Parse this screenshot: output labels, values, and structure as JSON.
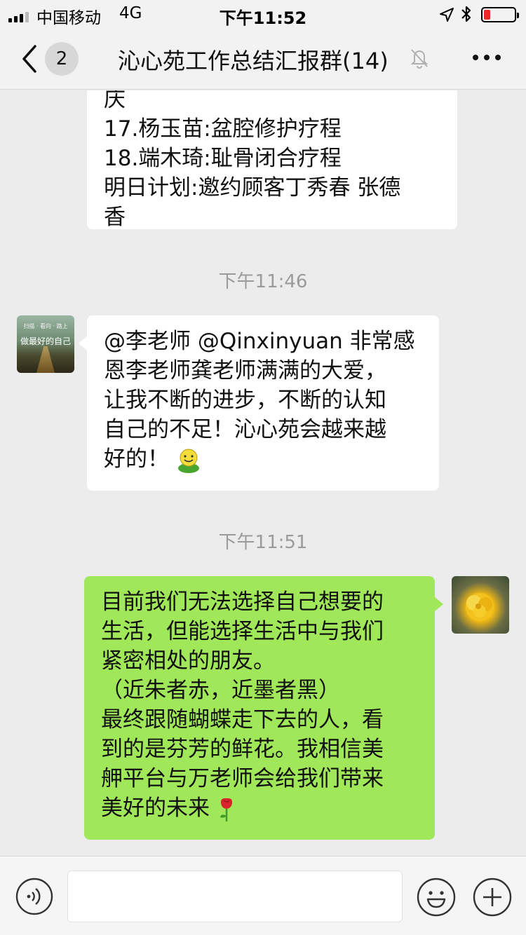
{
  "status_bar": {
    "carrier": "中国移动",
    "network": "4G",
    "time": "下午11:52"
  },
  "nav": {
    "unread_count": "2",
    "title": "沁心苑工作总结汇报群(14)"
  },
  "messages": [
    {
      "type": "incoming-partial",
      "lines": [
        "庆",
        "17.杨玉苗:盆腔修护疗程",
        "18.端木琦:耻骨闭合疗程",
        "明日计划:邀约顾客丁秀春 张德",
        "香"
      ]
    },
    {
      "type": "timestamp",
      "text": "下午11:46"
    },
    {
      "type": "incoming",
      "avatar_text": "做最好的自己",
      "avatar_small_text": "扫描 · 看向 · 路上",
      "lines": [
        "@李老师 @Qinxinyuan 非常感",
        "恩李老师龚老师满满的大爱，",
        "让我不断的进步，不断的认知",
        "自己的不足！沁心苑会越来越",
        "好的！"
      ],
      "emoji": "grin-emoji"
    },
    {
      "type": "timestamp",
      "text": "下午11:51"
    },
    {
      "type": "outgoing",
      "lines": [
        "目前我们无法选择自己想要的",
        "生活，但能选择生活中与我们",
        "紧密相处的朋友。",
        "（近朱者赤，近墨者黑）",
        "最终跟随蝴蝶走下去的人，看",
        "到的是芬芳的鲜花。我相信美",
        "舺平台与万老师会给我们带来",
        "美好的未来"
      ],
      "emoji": "rose-emoji"
    }
  ],
  "input_bar": {
    "placeholder": ""
  },
  "colors": {
    "chat_background": "#ececec",
    "bubble_white": "#ffffff",
    "bubble_green": "#a0e75a",
    "timestamp": "#9b9b9b",
    "battery_low": "#e82a2a"
  }
}
